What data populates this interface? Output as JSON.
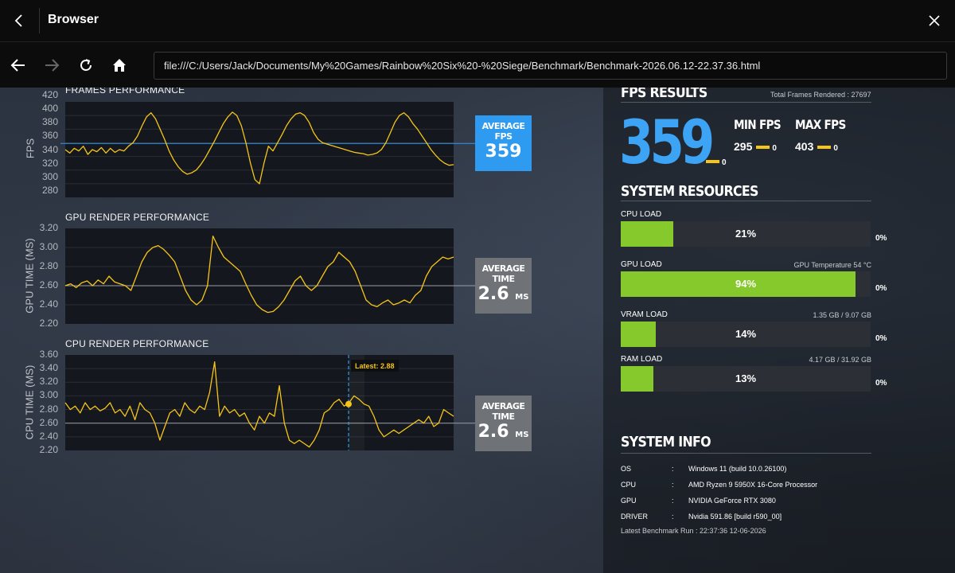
{
  "browser": {
    "title": "Browser",
    "url": "file:///C:/Users/Jack/Documents/My%20Games/Rainbow%20Six%20-%20Siege/Benchmark/Benchmark-2026.06.12-22.37.36.html"
  },
  "icons": {
    "title_back": "chevron-left-icon",
    "close": "close-icon",
    "back": "arrow-left-icon",
    "forward": "arrow-right-icon",
    "reload": "reload-icon",
    "home": "home-icon"
  },
  "colors": {
    "accent_blue": "#2e9bf0",
    "series_yellow": "#f5c518",
    "bar_green": "#86c92d",
    "grey_box": "#6f7378"
  },
  "charts": {
    "frames": {
      "title": "FRAMES PERFORMANCE",
      "ylabel": "FPS",
      "yticks": [
        "420",
        "400",
        "380",
        "360",
        "340",
        "320",
        "300",
        "280"
      ],
      "avg_label": "AVERAGE FPS",
      "avg_value": "359",
      "avg_unit": ""
    },
    "gpu": {
      "title": "GPU RENDER PERFORMANCE",
      "ylabel": "GPU TIME (MS)",
      "yticks": [
        "3.20",
        "3.00",
        "2.80",
        "2.60",
        "2.40",
        "2.20"
      ],
      "avg_label": "AVERAGE TIME",
      "avg_value": "2.6",
      "avg_unit": "MS"
    },
    "cpu": {
      "title": "CPU RENDER PERFORMANCE",
      "ylabel": "CPU TIME (MS)",
      "yticks": [
        "3.60",
        "3.40",
        "3.20",
        "3.00",
        "2.80",
        "2.60",
        "2.40",
        "2.20"
      ],
      "avg_label": "AVERAGE TIME",
      "avg_value": "2.6",
      "avg_unit": "MS",
      "tooltip": "Latest: 2.88"
    }
  },
  "chart_data": [
    {
      "type": "line",
      "title": "FRAMES PERFORMANCE",
      "ylabel": "FPS",
      "ylim": [
        280,
        420
      ],
      "average": 359,
      "y": [
        350,
        345,
        352,
        348,
        355,
        343,
        350,
        347,
        353,
        345,
        352,
        346,
        350,
        348,
        355,
        360,
        370,
        385,
        398,
        404,
        395,
        380,
        365,
        348,
        335,
        325,
        318,
        314,
        316,
        320,
        328,
        338,
        350,
        362,
        375,
        388,
        398,
        405,
        400,
        385,
        360,
        330,
        306,
        300,
        330,
        355,
        348,
        360,
        372,
        385,
        395,
        402,
        404,
        400,
        390,
        375,
        365,
        360,
        358,
        356,
        354,
        352,
        350,
        348,
        346,
        345,
        344,
        342,
        343,
        345,
        350,
        360,
        375,
        390,
        400,
        404,
        398,
        388,
        380,
        370,
        360,
        350,
        342,
        335,
        330,
        327,
        328
      ]
    },
    {
      "type": "line",
      "title": "GPU RENDER PERFORMANCE",
      "ylabel": "GPU TIME (MS)",
      "ylim": [
        2.2,
        3.2
      ],
      "average": 2.6,
      "y": [
        2.6,
        2.62,
        2.58,
        2.63,
        2.65,
        2.6,
        2.66,
        2.62,
        2.7,
        2.64,
        2.62,
        2.6,
        2.55,
        2.7,
        2.85,
        2.95,
        3.0,
        3.02,
        2.98,
        2.92,
        2.85,
        2.7,
        2.55,
        2.45,
        2.4,
        2.45,
        2.6,
        3.12,
        3.0,
        2.9,
        2.85,
        2.8,
        2.75,
        2.62,
        2.5,
        2.4,
        2.35,
        2.32,
        2.33,
        2.38,
        2.45,
        2.55,
        2.65,
        2.7,
        2.6,
        2.55,
        2.6,
        2.7,
        2.8,
        2.85,
        2.95,
        2.9,
        2.85,
        2.75,
        2.6,
        2.45,
        2.4,
        2.38,
        2.42,
        2.45,
        2.4,
        2.42,
        2.45,
        2.42,
        2.5,
        2.55,
        2.7,
        2.8,
        2.85,
        2.9,
        2.88,
        2.9
      ]
    },
    {
      "type": "line",
      "title": "CPU RENDER PERFORMANCE",
      "ylabel": "CPU TIME (MS)",
      "ylim": [
        2.2,
        3.6
      ],
      "average": 2.6,
      "y": [
        2.9,
        2.8,
        2.85,
        2.75,
        2.9,
        2.8,
        2.85,
        2.78,
        2.82,
        2.9,
        2.75,
        2.8,
        2.7,
        2.85,
        2.65,
        2.9,
        2.8,
        2.75,
        2.6,
        2.35,
        2.55,
        2.75,
        2.8,
        2.7,
        2.9,
        2.8,
        2.75,
        2.85,
        2.8,
        3.05,
        3.5,
        2.7,
        2.85,
        2.75,
        2.8,
        2.7,
        2.75,
        2.6,
        2.5,
        2.7,
        2.6,
        2.75,
        2.7,
        3.15,
        2.6,
        2.35,
        2.3,
        2.35,
        2.3,
        2.25,
        2.35,
        2.5,
        2.75,
        2.8,
        2.9,
        2.95,
        2.85,
        2.9,
        3.0,
        2.95,
        2.88,
        2.85,
        2.7,
        2.5,
        2.4,
        2.45,
        2.5,
        2.45,
        2.5,
        2.55,
        2.6,
        2.65,
        2.6,
        2.7,
        2.55,
        2.6,
        2.8,
        2.75,
        2.7
      ],
      "latest": 2.88
    }
  ],
  "fps_results": {
    "title": "FPS RESULTS",
    "total_frames": "Total Frames Rendered : 27697",
    "average": "359",
    "average_zero": "0",
    "min_title": "MIN FPS",
    "min_value": "295",
    "min_zero": "0",
    "max_title": "MAX FPS",
    "max_value": "403",
    "max_zero": "0"
  },
  "system_resources": {
    "title": "SYSTEM RESOURCES",
    "items": [
      {
        "label": "CPU LOAD",
        "percent": 21,
        "percent_text": "21%",
        "note": "",
        "zero": "0%"
      },
      {
        "label": "GPU LOAD",
        "percent": 94,
        "percent_text": "94%",
        "note": "GPU Temperature 54 °C",
        "zero": "0%"
      },
      {
        "label": "VRAM LOAD",
        "percent": 14,
        "percent_text": "14%",
        "note": "1.35 GB / 9.07 GB",
        "zero": "0%"
      },
      {
        "label": "RAM LOAD",
        "percent": 13,
        "percent_text": "13%",
        "note": "4.17 GB / 31.92 GB",
        "zero": "0%"
      }
    ]
  },
  "system_info": {
    "title": "SYSTEM INFO",
    "rows": [
      {
        "key": "OS",
        "colon": ":",
        "value": "Windows 11 (build 10.0.26100)"
      },
      {
        "key": "CPU",
        "colon": ":",
        "value": "AMD Ryzen 9 5950X 16-Core Processor"
      },
      {
        "key": "GPU",
        "colon": ":",
        "value": "NVIDIA GeForce RTX 3080"
      },
      {
        "key": "DRIVER",
        "colon": ":",
        "value": "Nvidia 591.86 [build r590_00]"
      }
    ],
    "latest_run": "Latest Benchmark Run : 22:37:36 12-06-2026"
  }
}
